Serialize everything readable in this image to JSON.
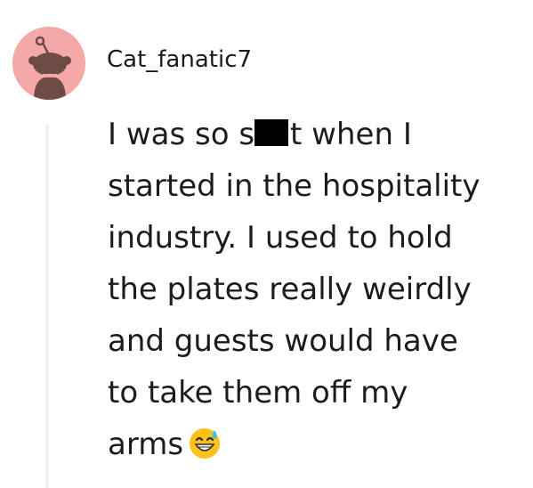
{
  "comment": {
    "author": "Cat_fanatic7",
    "avatar_icon": "snoo-avatar-icon",
    "avatar_color": "#f4a9a7",
    "line1_before": "I was so s",
    "line1_after": "t when I",
    "line2": "started in the hospitality",
    "line3": "industry. I used to hold",
    "line4": "the plates really weirdly",
    "line5": "and guests would have",
    "line6": "to take them off my",
    "line7": "arms",
    "emoji": "grinning-face-with-sweat-icon"
  }
}
